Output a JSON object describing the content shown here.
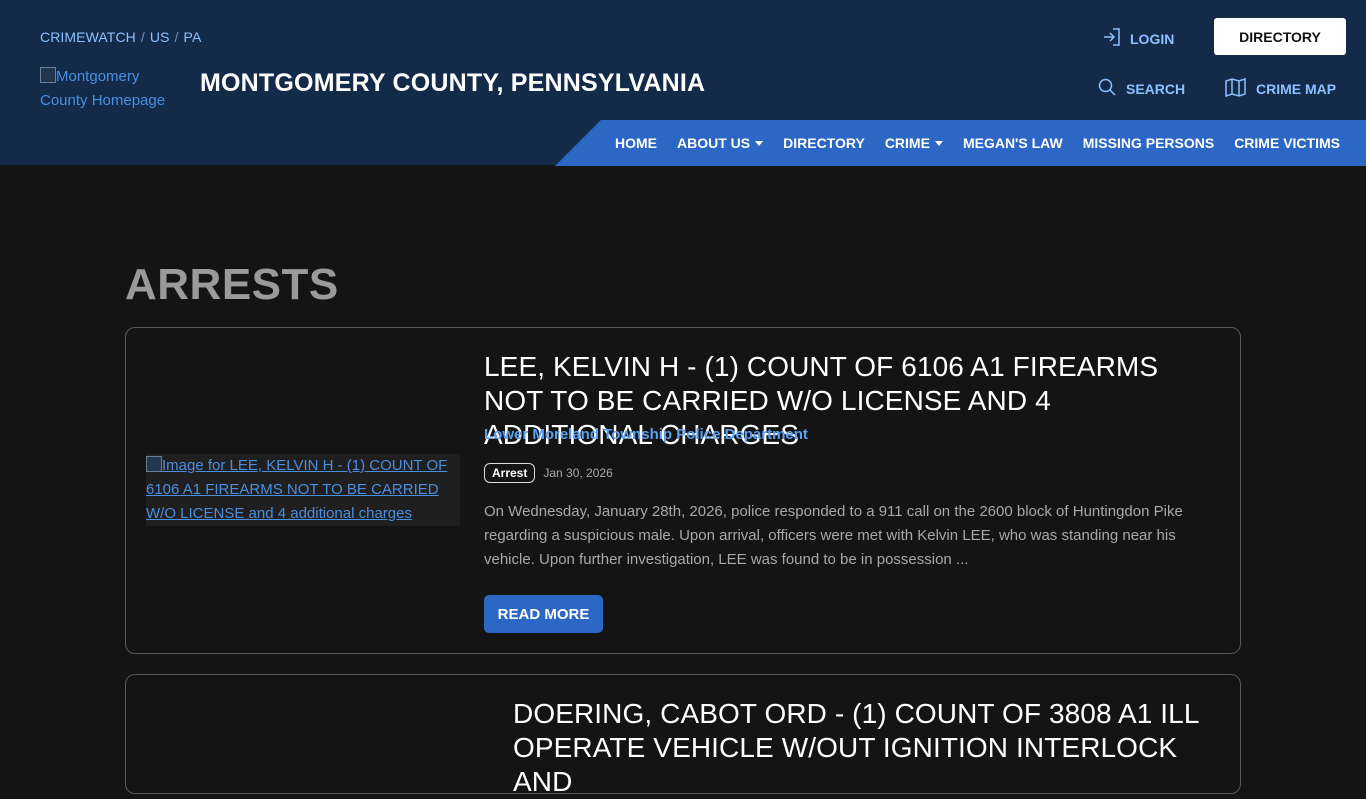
{
  "header": {
    "breadcrumb": [
      "CRIMEWATCH",
      "US",
      "PA"
    ],
    "breadcrumb_sep": "/",
    "logo_alt": "Montgomery County Homepage",
    "site_title": "MONTGOMERY COUNTY, PENNSYLVANIA",
    "login_label": "LOGIN",
    "directory_button": "DIRECTORY",
    "search_label": "SEARCH",
    "crime_map_label": "CRIME MAP"
  },
  "nav": {
    "items": [
      {
        "label": "HOME",
        "dropdown": false
      },
      {
        "label": "ABOUT US",
        "dropdown": true
      },
      {
        "label": "DIRECTORY",
        "dropdown": false
      },
      {
        "label": "CRIME",
        "dropdown": true
      },
      {
        "label": "MEGAN'S LAW",
        "dropdown": false
      },
      {
        "label": "MISSING PERSONS",
        "dropdown": false
      },
      {
        "label": "CRIME VICTIMS",
        "dropdown": false
      }
    ]
  },
  "main": {
    "heading": "ARRESTS",
    "posts": [
      {
        "image_alt": "Image for LEE, KELVIN H - (1) COUNT OF 6106 A1 FIREARMS NOT TO BE CARRIED W/O LICENSE and 4 additional charges",
        "title": "LEE, KELVIN H - (1) COUNT OF 6106 A1 FIREARMS NOT TO BE CARRIED W/O LICENSE AND 4 ADDITIONAL CHARGES",
        "agency": "Lower Moreland Township Police Department",
        "tag": "Arrest",
        "date": "Jan 30, 2026",
        "excerpt": "On Wednesday, January 28th, 2026, police responded to a 911 call on the 2600 block of Huntingdon Pike regarding a suspicious male. Upon arrival, officers were met with Kelvin LEE, who was standing near his vehicle. Upon further investigation, LEE was found to be in possession ...",
        "read_more": "READ MORE"
      },
      {
        "title": "DOERING, CABOT ORD - (1) COUNT OF 3808 A1 ILL OPERATE VEHICLE W/OUT IGNITION INTERLOCK AND"
      }
    ]
  },
  "colors": {
    "header_bg": "#142a49",
    "nav_bg": "#2d67c6",
    "page_bg": "#141414",
    "link": "#5aa0f0"
  }
}
